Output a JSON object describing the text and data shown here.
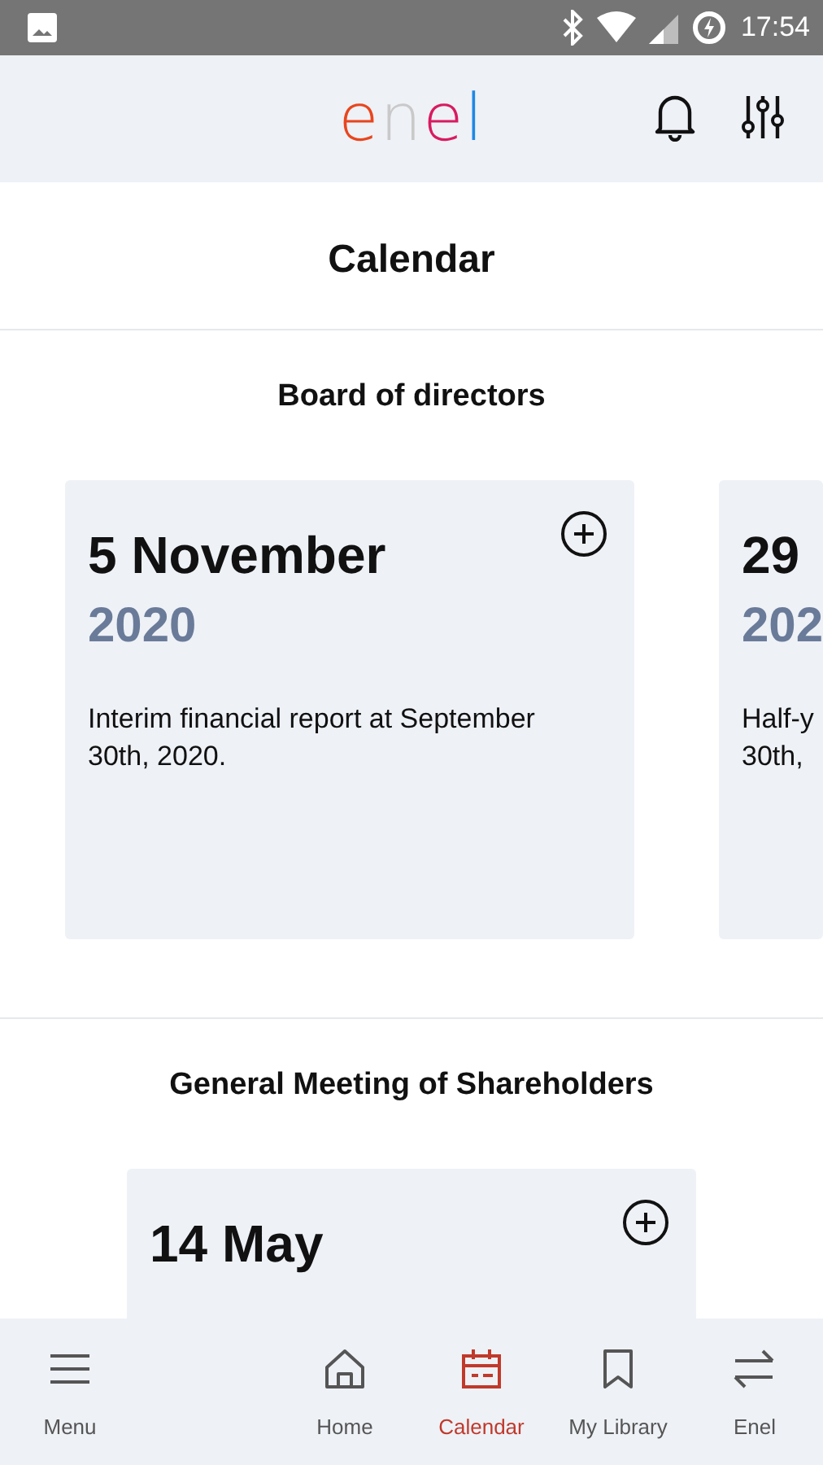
{
  "status_bar": {
    "time": "17:54"
  },
  "header": {
    "logo": "enel"
  },
  "title": "Calendar",
  "sections": [
    {
      "heading": "Board of directors",
      "events": [
        {
          "date": "5 November",
          "year": "2020",
          "description": "Interim financial report at September 30th, 2020."
        },
        {
          "date": "29",
          "year": "202",
          "description": "Half-y 30th,"
        }
      ]
    },
    {
      "heading": "General Meeting of Shareholders",
      "events": [
        {
          "date": "14 May"
        }
      ]
    }
  ],
  "nav": [
    {
      "kind": "menu",
      "label": "Menu",
      "selected": false
    },
    {
      "kind": "home",
      "label": "Home",
      "selected": false
    },
    {
      "kind": "calendar",
      "label": "Calendar",
      "selected": true
    },
    {
      "kind": "bookmark",
      "label": "My Library",
      "selected": false
    },
    {
      "kind": "swap",
      "label": "Enel",
      "selected": false
    }
  ]
}
